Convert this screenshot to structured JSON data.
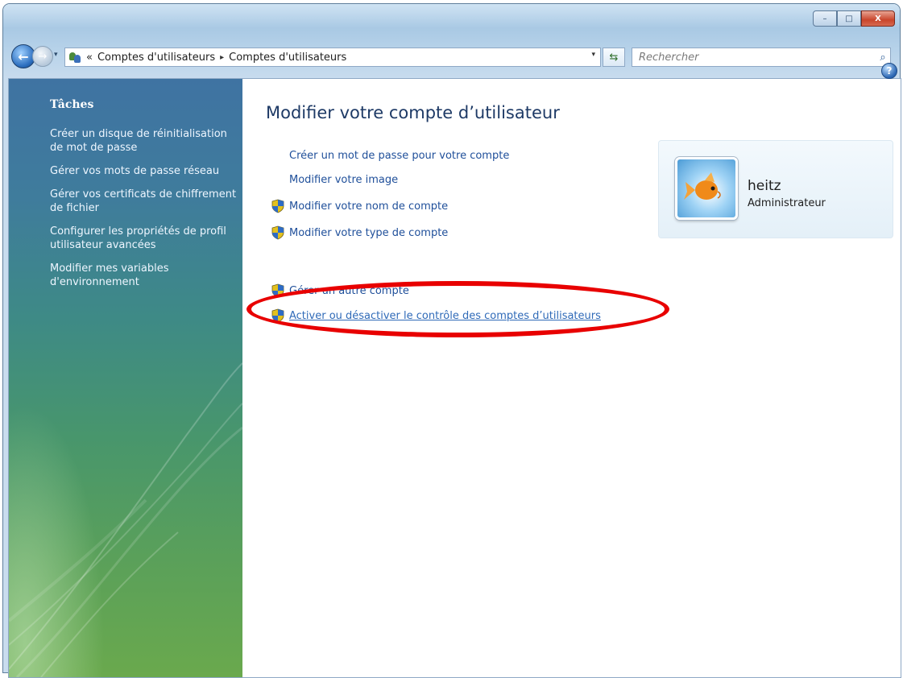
{
  "window": {
    "caption_buttons": {
      "minimize": "–",
      "maximize": "□",
      "close": "X"
    }
  },
  "navbar": {
    "back_glyph": "←",
    "forward_glyph": "→",
    "dropdown_glyph": "▾",
    "breadcrumb_prefix": "«",
    "breadcrumbs": [
      "Comptes d'utilisateurs",
      "Comptes d'utilisateurs"
    ],
    "separator": "▸",
    "address_dropdown_glyph": "▾",
    "refresh_glyph": "⇆",
    "search_placeholder": "Rechercher",
    "search_glyph": "⌕"
  },
  "sidebar": {
    "title": "Tâches",
    "links": [
      "Créer un disque de réinitialisation de mot de passe",
      "Gérer vos mots de passe réseau",
      "Gérer vos certificats de chiffrement de fichier",
      "Configurer les propriétés de profil utilisateur avancées",
      "Modifier mes variables d'environnement"
    ]
  },
  "main": {
    "help_glyph": "?",
    "title": "Modifier votre compte d’utilisateur",
    "tasks": [
      {
        "label": "Créer un mot de passe pour votre compte",
        "shield": false
      },
      {
        "label": "Modifier votre image",
        "shield": false
      },
      {
        "label": "Modifier votre nom de compte",
        "shield": true
      },
      {
        "label": "Modifier votre type de compte",
        "shield": true
      },
      {
        "label": "Gérer un autre compte",
        "shield": true
      },
      {
        "label": "Activer ou désactiver le contrôle des comptes d’utilisateurs",
        "shield": true
      }
    ]
  },
  "user": {
    "name": "heitz",
    "role": "Administrateur"
  },
  "colors": {
    "annotation": "#e80000",
    "link": "#1f4f9a",
    "title": "#1e3a66"
  }
}
